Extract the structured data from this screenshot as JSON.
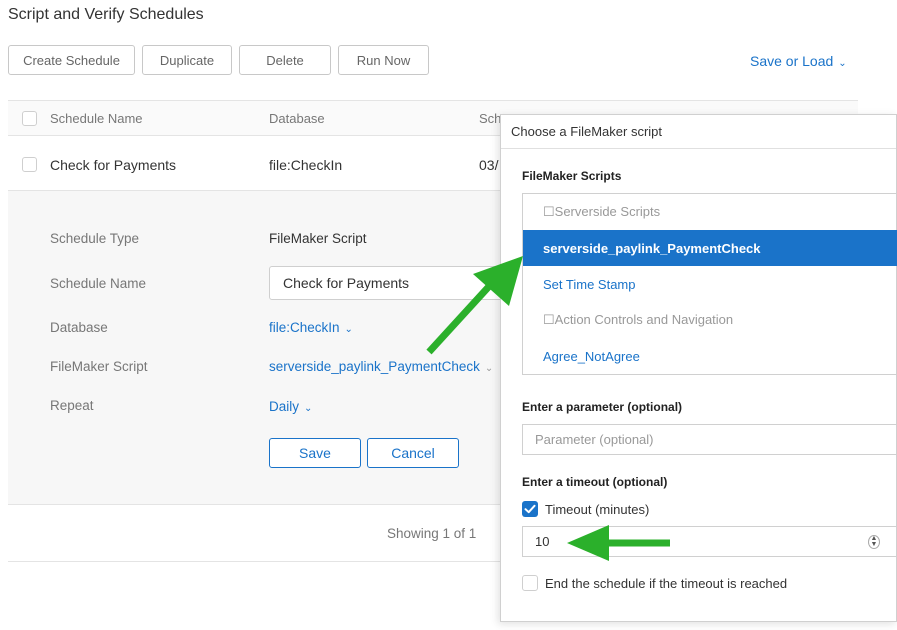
{
  "page": {
    "title": "Script and Verify Schedules"
  },
  "toolbar": {
    "create_label": "Create Schedule",
    "duplicate_label": "Duplicate",
    "delete_label": "Delete",
    "run_now_label": "Run Now",
    "save_load_label": "Save or Load"
  },
  "table": {
    "headers": {
      "name": "Schedule Name",
      "database": "Database",
      "scheduled_partial": "Sch"
    },
    "row": {
      "name": "Check for Payments",
      "database": "file:CheckIn",
      "date_partial": "03/"
    },
    "showing": "Showing 1 of 1"
  },
  "detail": {
    "labels": {
      "type": "Schedule Type",
      "name": "Schedule Name",
      "database": "Database",
      "script": "FileMaker Script",
      "repeat": "Repeat"
    },
    "values": {
      "type": "FileMaker Script",
      "name": "Check for Payments",
      "database": "file:CheckIn",
      "script": "serverside_paylink_PaymentCheck",
      "repeat": "Daily"
    },
    "save_label": "Save",
    "cancel_label": "Cancel"
  },
  "popup": {
    "title": "Choose a FileMaker script",
    "scripts_label": "FileMaker Scripts",
    "scripts": [
      {
        "label": "☐Serverside Scripts",
        "kind": "folder"
      },
      {
        "label": "serverside_paylink_PaymentCheck",
        "kind": "selected"
      },
      {
        "label": "Set Time Stamp",
        "kind": "script"
      },
      {
        "label": "☐Action Controls and Navigation",
        "kind": "folder"
      },
      {
        "label": "Agree_NotAgree",
        "kind": "script"
      }
    ],
    "parameter_label": "Enter a parameter (optional)",
    "parameter_placeholder": "Parameter (optional)",
    "timeout_label": "Enter a timeout (optional)",
    "timeout_checkbox_label": "Timeout (minutes)",
    "timeout_checked": true,
    "timeout_value": "10",
    "end_schedule_label": "End the schedule if the timeout is reached",
    "end_schedule_checked": false
  },
  "colors": {
    "accent": "#1a73c9",
    "annotation_arrow": "#2bb02b"
  },
  "icons": {
    "dropdown": "chevron-down-icon",
    "checkmark": "check-icon",
    "spinner": "stepper-icon"
  }
}
